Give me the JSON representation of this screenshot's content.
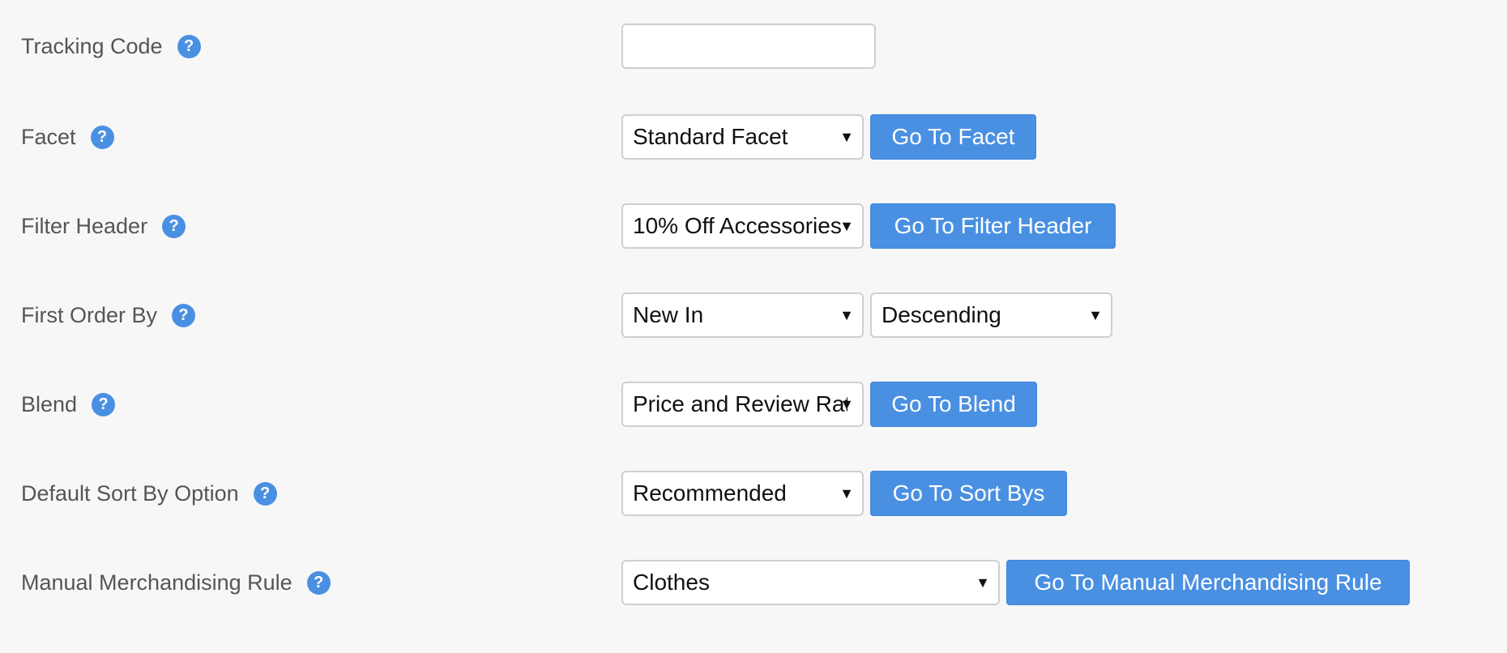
{
  "colors": {
    "accent": "#4a90e2",
    "background": "#f7f7f7",
    "label_text": "#555555",
    "border": "#cfcfcf"
  },
  "help_icon": {
    "name": "question-circle-icon",
    "glyph": "?"
  },
  "caret_icon": {
    "name": "caret-down-icon",
    "glyph": "▼"
  },
  "rows": {
    "tracking_code": {
      "label": "Tracking Code",
      "value": "",
      "placeholder": ""
    },
    "facet": {
      "label": "Facet",
      "select": "Standard Facet",
      "button": "Go To Facet"
    },
    "filter_header": {
      "label": "Filter Header",
      "select": "10% Off Accessories",
      "button": "Go To Filter Header"
    },
    "first_order_by": {
      "label": "First Order By",
      "select": "New In",
      "direction": "Descending"
    },
    "blend": {
      "label": "Blend",
      "select": "Price and Review Rating",
      "button": "Go To Blend"
    },
    "default_sort_by": {
      "label": "Default Sort By Option",
      "select": "Recommended",
      "button": "Go To Sort Bys"
    },
    "manual_merch_rule": {
      "label": "Manual Merchandising Rule",
      "select": "Clothes",
      "button": "Go To Manual Merchandising Rule"
    }
  }
}
